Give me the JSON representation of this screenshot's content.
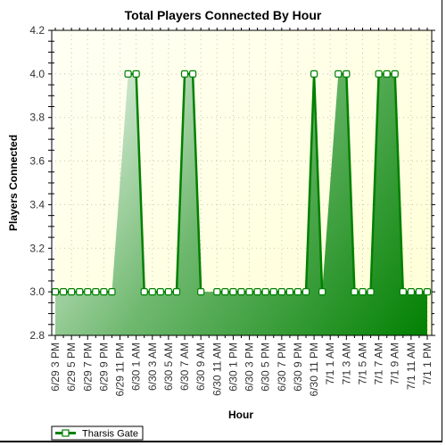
{
  "chart_data": {
    "type": "area",
    "title": "Total Players Connected By Hour",
    "xlabel": "Hour",
    "ylabel": "Players Connected",
    "ylim": [
      2.8,
      4.2
    ],
    "yticks": [
      "2.8",
      "3.0",
      "3.2",
      "3.4",
      "3.6",
      "3.8",
      "4.0",
      "4.2"
    ],
    "x_tick_labels": [
      "6/29 3 PM",
      "6/29 5 PM",
      "6/29 7 PM",
      "6/29 9 PM",
      "6/29 11 PM",
      "6/30 1 AM",
      "6/30 3 AM",
      "6/30 5 AM",
      "6/30 7 AM",
      "6/30 9 AM",
      "6/30 11 AM",
      "6/30 1 PM",
      "6/30 3 PM",
      "6/30 5 PM",
      "6/30 7 PM",
      "6/30 9 PM",
      "6/30 11 PM",
      "7/1 1 AM",
      "7/1 3 AM",
      "7/1 5 AM",
      "7/1 7 AM",
      "7/1 9 AM",
      "7/1 11 AM",
      "7/1 1 PM"
    ],
    "x_step_hours": 1,
    "grid": true,
    "legend_position": "bottom-left",
    "series": [
      {
        "name": "Tharsis Gate",
        "color": "#008000",
        "values": [
          3,
          3,
          3,
          3,
          3,
          3,
          3,
          3,
          null,
          4,
          4,
          3,
          3,
          3,
          3,
          3,
          4,
          4,
          3,
          null,
          3,
          3,
          3,
          3,
          3,
          3,
          3,
          3,
          3,
          3,
          3,
          3,
          4,
          3,
          null,
          4,
          4,
          3,
          3,
          3,
          4,
          4,
          4,
          3,
          3,
          3,
          3
        ]
      }
    ]
  },
  "colors": {
    "plot_bg_light": "#fffff0",
    "plot_bg_yellow": "#ffffd8",
    "fill_light": "#e8f3e8",
    "fill_dark": "#008000",
    "line": "#007a00"
  }
}
